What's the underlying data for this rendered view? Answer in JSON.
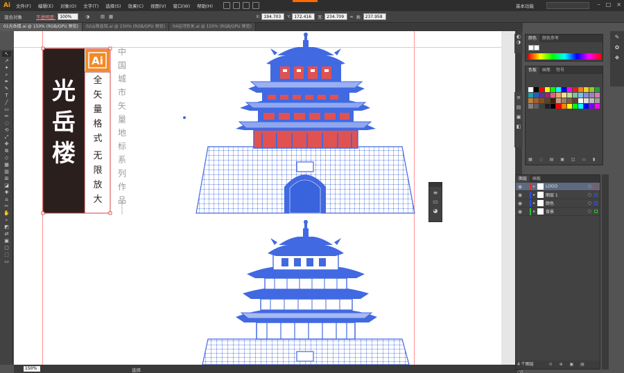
{
  "app": {
    "logo": "Ai",
    "workspace": "基本功能",
    "colors": {
      "accent": "#ff9a00",
      "selection_blue": "#4169e1",
      "guide": "#ff9090"
    }
  },
  "menu": [
    "文件(F)",
    "编辑(E)",
    "对象(O)",
    "文字(T)",
    "选择(S)",
    "效果(C)",
    "视图(V)",
    "窗口(W)",
    "帮助(H)"
  ],
  "control": {
    "mode_label": "混合对象",
    "opacity_link": "不透明度:",
    "opacity_value": "100%",
    "x_label": "X:",
    "x_value": "194.703",
    "y_label": "Y:",
    "y_value": "172.416",
    "w_label": "宽:",
    "w_value": "234.709",
    "h_label": "高:",
    "h_value": "237.958"
  },
  "doc_tabs": [
    {
      "label": "01光岳楼.ai @ 150% (RGB/GPU 预览)",
      "active": true
    },
    {
      "label": "02山陕会馆.ai @ 150% (RGB/GPU 预览)",
      "active": false
    },
    {
      "label": "04运河钞关.ai @ 150% (RGB/GPU 预览)",
      "active": false
    }
  ],
  "artwork": {
    "title": "光岳楼",
    "badge": "Ai",
    "subtitle": "全矢量格式 无限放大",
    "vertical_text": "中国城市矢量地标系列作品"
  },
  "status": {
    "zoom": "150%",
    "tool": "选择"
  },
  "panels": {
    "color_tabs": [
      "颜色",
      "颜色参考"
    ],
    "swatch_tabs": [
      "色板",
      "画笔",
      "符号"
    ],
    "layer_tabs": [
      "图层",
      "画板"
    ],
    "layers": [
      {
        "name": "LOGO",
        "color": "#e03030",
        "highlight": true
      },
      {
        "name": "图层 1",
        "color": "#3050e0",
        "highlight": false
      },
      {
        "name": "颜色",
        "color": "#3050e0",
        "highlight": false
      },
      {
        "name": "背景",
        "color": "#30c030",
        "highlight": false
      }
    ],
    "layer_count": "4 个图层"
  }
}
